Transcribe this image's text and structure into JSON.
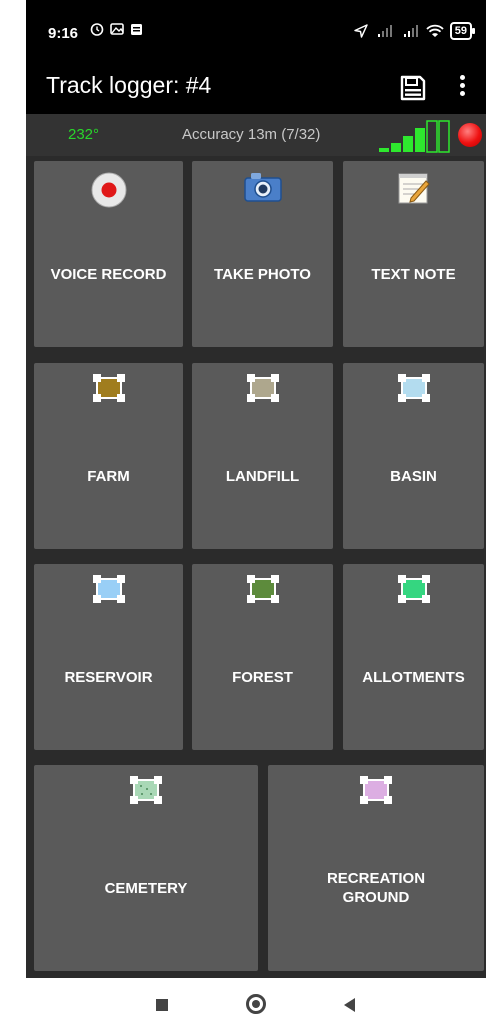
{
  "status_bar": {
    "time": "9:16",
    "battery": "59",
    "left_icons": [
      "alarm-icon",
      "photo-notification-icon",
      "message-icon"
    ],
    "right_icons": [
      "location-icon",
      "signal-icon",
      "signal-icon",
      "wifi-icon",
      "battery-icon"
    ]
  },
  "toolbar": {
    "title": "Track logger: #4",
    "actions": [
      "save-icon",
      "more-options-icon"
    ]
  },
  "info": {
    "heading": "232°",
    "accuracy": "Accuracy 13m (7/32)"
  },
  "tiles": [
    {
      "label": "VOICE RECORD",
      "icon": "record-icon"
    },
    {
      "label": "TAKE PHOTO",
      "icon": "camera-icon"
    },
    {
      "label": "TEXT NOTE",
      "icon": "notepad-icon"
    },
    {
      "label": "FARM",
      "icon": "area-icon",
      "color": "#a07d1e"
    },
    {
      "label": "LANDFILL",
      "icon": "area-icon",
      "color": "#aea78d"
    },
    {
      "label": "BASIN",
      "icon": "area-icon",
      "color": "#b3dcef"
    },
    {
      "label": "RESERVOIR",
      "icon": "area-icon",
      "color": "#99cff6"
    },
    {
      "label": "FOREST",
      "icon": "area-icon",
      "color": "#5d8b3c"
    },
    {
      "label": "ALLOTMENTS",
      "icon": "area-icon",
      "color": "#35d680"
    },
    {
      "label": "CEMETERY",
      "icon": "area-icon",
      "color": "#a9d8b6"
    },
    {
      "label": "RECREATION GROUND",
      "icon": "area-icon",
      "color": "#dcaee2"
    }
  ],
  "colors": {
    "heading_green": "#29d62b",
    "tile_bg": "#5a5a5a",
    "background": "#2b2b2b",
    "record_red": "#ee1111"
  },
  "nav": [
    "recents-icon",
    "home-icon",
    "back-icon"
  ]
}
